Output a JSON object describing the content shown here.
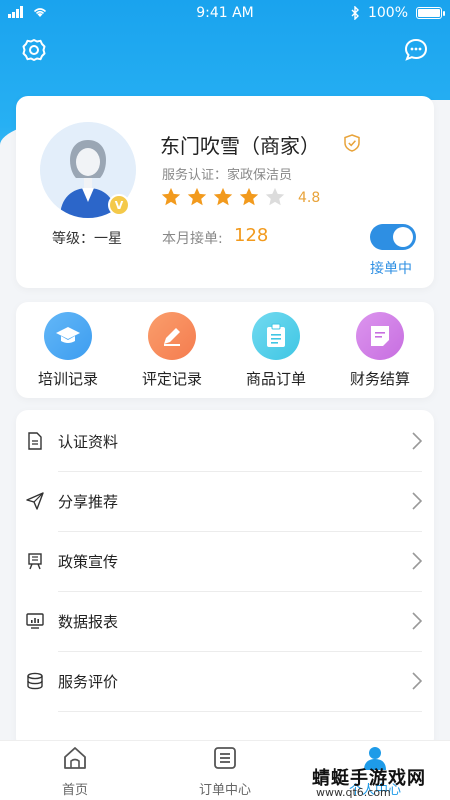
{
  "status_bar": {
    "time": "9:41 AM",
    "battery": "100%"
  },
  "header": {
    "settings_icon": "settings-icon",
    "chat_icon": "chat-icon",
    "accent": "#1aa3ee"
  },
  "profile": {
    "name": "东门吹雪（商家）",
    "service_cert": "服务认证：家政保洁员",
    "rating": "4.8",
    "stars_filled": 4,
    "stars_total": 5,
    "level": "等级：一星",
    "vip_badge": "V",
    "orders_label": "本月接单:",
    "orders_count": "128",
    "toggle_on": true,
    "toggle_label": "接单中"
  },
  "quick_actions": [
    {
      "label": "培训记录",
      "icon": "graduation-cap-icon",
      "color": "#3d9df0"
    },
    {
      "label": "评定记录",
      "icon": "pen-icon",
      "color": "#f57c4f"
    },
    {
      "label": "商品订单",
      "icon": "clipboard-icon",
      "color": "#3fc6e4"
    },
    {
      "label": "财务结算",
      "icon": "note-icon",
      "color": "#c76ee0"
    }
  ],
  "menu": [
    {
      "label": "认证资料",
      "icon": "document-icon"
    },
    {
      "label": "分享推荐",
      "icon": "paper-plane-icon"
    },
    {
      "label": "政策宣传",
      "icon": "policy-icon"
    },
    {
      "label": "数据报表",
      "icon": "monitor-chart-icon"
    },
    {
      "label": "服务评价",
      "icon": "database-icon"
    }
  ],
  "tabbar": [
    {
      "label": "首页",
      "icon": "home-icon"
    },
    {
      "label": "订单中心",
      "icon": "list-icon"
    },
    {
      "label": "个人中心",
      "icon": "user-icon"
    }
  ],
  "watermark": {
    "text": "蜻蜓手游戏网",
    "url": "www.qt6.com"
  }
}
